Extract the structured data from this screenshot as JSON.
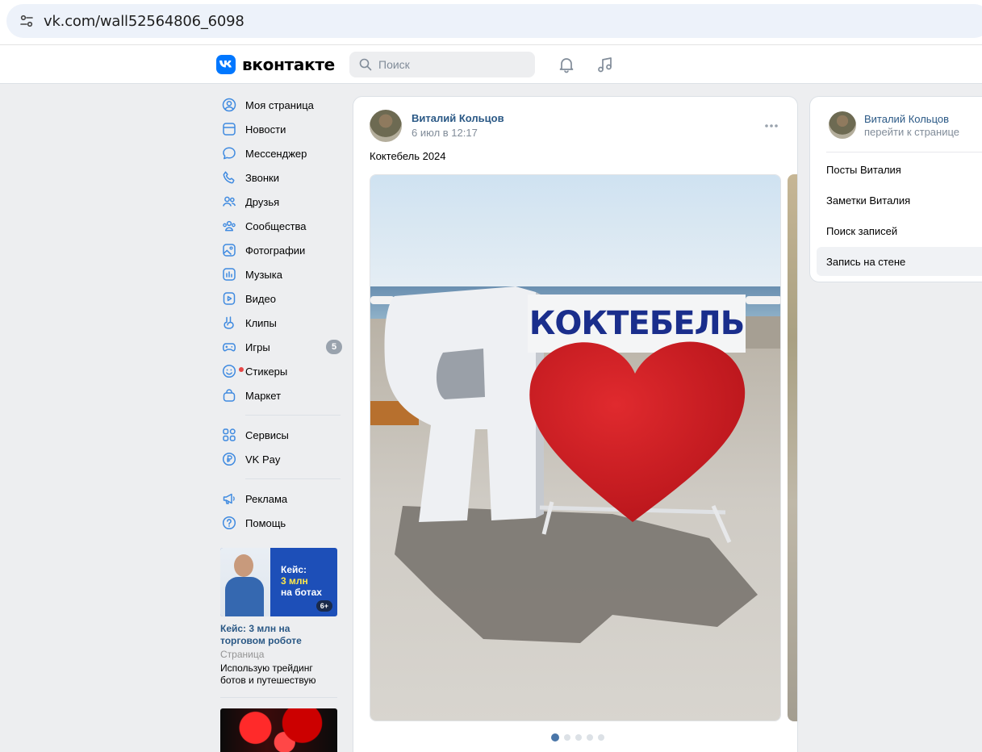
{
  "browser": {
    "url": "vk.com/wall52564806_6098"
  },
  "header": {
    "logo_text": "вконтакте",
    "search_placeholder": "Поиск",
    "icons": [
      "notifications-bell-icon",
      "music-icon"
    ]
  },
  "nav": {
    "items": [
      {
        "label": "Моя страница",
        "icon": "profile-icon"
      },
      {
        "label": "Новости",
        "icon": "news-icon"
      },
      {
        "label": "Мессенджер",
        "icon": "messenger-icon"
      },
      {
        "label": "Звонки",
        "icon": "phone-icon"
      },
      {
        "label": "Друзья",
        "icon": "friends-icon"
      },
      {
        "label": "Сообщества",
        "icon": "communities-icon"
      },
      {
        "label": "Фотографии",
        "icon": "photos-icon"
      },
      {
        "label": "Музыка",
        "icon": "music-icon"
      },
      {
        "label": "Видео",
        "icon": "video-icon"
      },
      {
        "label": "Клипы",
        "icon": "clips-icon"
      },
      {
        "label": "Игры",
        "icon": "games-icon",
        "badge": "5"
      },
      {
        "label": "Стикеры",
        "icon": "stickers-icon",
        "has_red_dot": true
      },
      {
        "label": "Маркет",
        "icon": "market-icon"
      }
    ],
    "services": [
      {
        "label": "Сервисы",
        "icon": "services-icon"
      },
      {
        "label": "VK Pay",
        "icon": "vk-pay-icon"
      }
    ],
    "misc": [
      {
        "label": "Реклама",
        "icon": "ads-megaphone-icon"
      },
      {
        "label": "Помощь",
        "icon": "help-icon"
      }
    ]
  },
  "ad": {
    "banner_line1": "Кейс:",
    "banner_line2": "3 млн",
    "banner_line3": "на ботах",
    "age_label": "6+",
    "title": "Кейс: 3 млн на торговом роботе",
    "type": "Страница",
    "description": "Использую трейдинг ботов и путешествую"
  },
  "post": {
    "author": "Виталий Кольцов",
    "time": "6 июл в 12:17",
    "text": "Коктебель 2024",
    "photo_sign_text": "КОКТЕБЕЛЬ",
    "photo_letter": "Я",
    "carousel": {
      "count": 5,
      "active_index": 0
    }
  },
  "right_panel": {
    "name": "Виталий Кольцов",
    "link": "перейти к странице",
    "items": [
      {
        "label": "Посты Виталия",
        "active": false
      },
      {
        "label": "Заметки Виталия",
        "active": false
      },
      {
        "label": "Поиск записей",
        "active": false
      },
      {
        "label": "Запись на стене",
        "active": true
      }
    ]
  },
  "colors": {
    "brand": "#0077ff",
    "link": "#2a5885",
    "page_bg": "#edeef0",
    "heart": "#d42027",
    "sign_text": "#1a2e8c"
  }
}
